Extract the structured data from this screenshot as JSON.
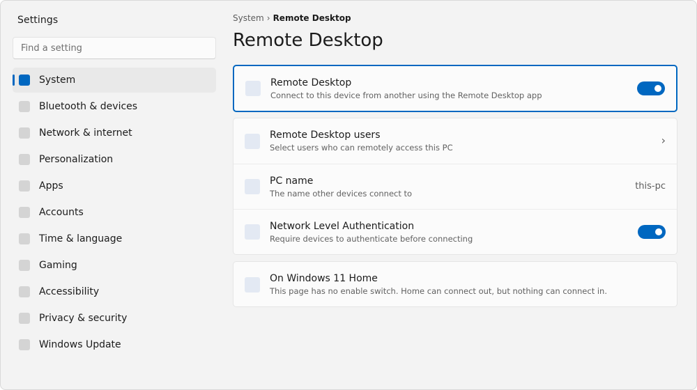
{
  "app": {
    "title": "Settings"
  },
  "search": {
    "placeholder": "Find a setting",
    "value": ""
  },
  "sidebar": {
    "items": [
      {
        "label": "System",
        "active": true
      },
      {
        "label": "Bluetooth & devices"
      },
      {
        "label": "Network & internet"
      },
      {
        "label": "Personalization"
      },
      {
        "label": "Apps"
      },
      {
        "label": "Accounts"
      },
      {
        "label": "Time & language"
      },
      {
        "label": "Gaming"
      },
      {
        "label": "Accessibility"
      },
      {
        "label": "Privacy & security"
      },
      {
        "label": "Windows Update"
      }
    ]
  },
  "breadcrumb": {
    "parent": "System",
    "separator": "›",
    "current": "Remote Desktop"
  },
  "page": {
    "title": "Remote Desktop"
  },
  "remote_desktop": {
    "title": "Remote Desktop",
    "description": "Connect to this device from another using the Remote Desktop app",
    "toggle_on": true
  },
  "settings": {
    "users": {
      "title": "Remote Desktop users",
      "description": "Select users who can remotely access this PC",
      "chevron": "›"
    },
    "pc_name": {
      "title": "PC name",
      "description": "The name other devices connect to",
      "value": "this-pc"
    },
    "nla": {
      "title": "Network Level Authentication",
      "description": "Require devices to authenticate before connecting",
      "toggle_on": true
    }
  },
  "info": {
    "title": "On Windows 11 Home",
    "description": "This page has no enable switch. Home can connect out, but nothing can connect in."
  },
  "colors": {
    "accent": "#0067c0",
    "window_bg": "#f3f3f3",
    "card_bg": "#fbfbfb"
  }
}
